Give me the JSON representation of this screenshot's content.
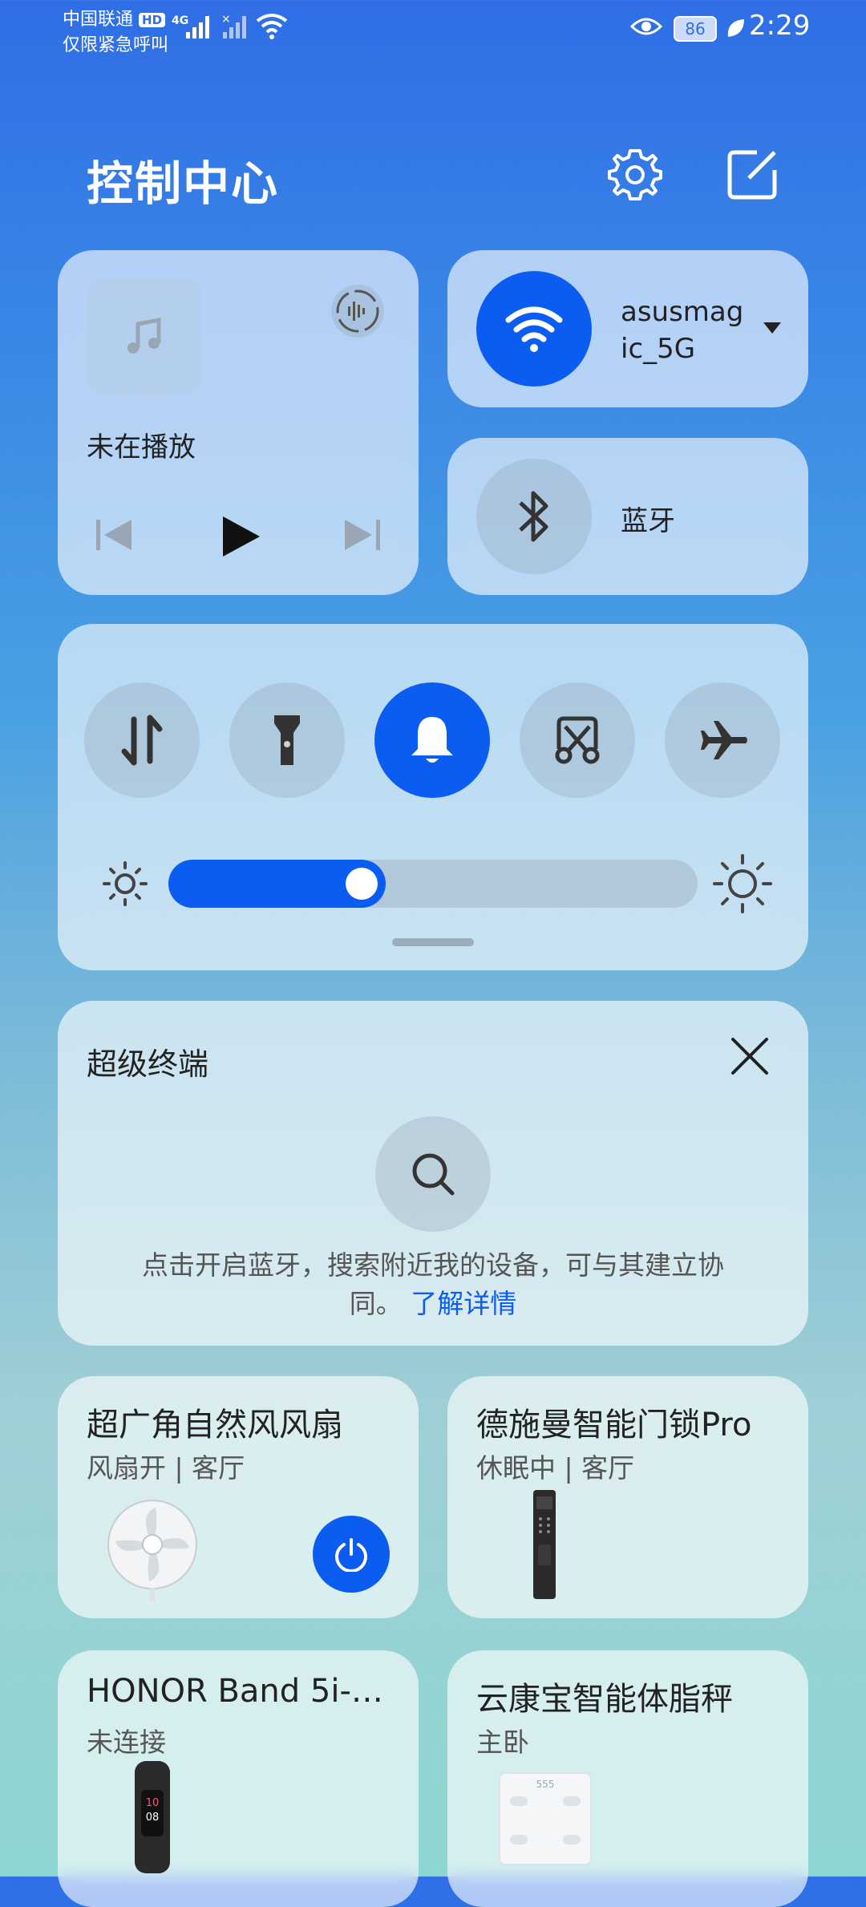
{
  "status": {
    "carrier": "中国联通",
    "hd": "HD",
    "emergency": "仅限紧急呼叫",
    "net": "4G",
    "battery": "86",
    "time": "2:29"
  },
  "header": {
    "title": "控制中心"
  },
  "media": {
    "status": "未在播放"
  },
  "wifi": {
    "ssid_line1": "asusmag",
    "ssid_line2": "ic_5G"
  },
  "bluetooth": {
    "label": "蓝牙"
  },
  "toggles": [
    {
      "name": "mobile-data",
      "active": false
    },
    {
      "name": "flashlight",
      "active": false
    },
    {
      "name": "sound",
      "active": true
    },
    {
      "name": "screenshot",
      "active": false
    },
    {
      "name": "airplane",
      "active": false
    }
  ],
  "brightness": {
    "level": 0.41
  },
  "superdevice": {
    "title": "超级终端",
    "desc_line1": "点击开启蓝牙，搜索附近我的设备，可与其建立协",
    "desc_line2": "同。",
    "link": "了解详情"
  },
  "devices": [
    {
      "title": "超广角自然风风扇",
      "status": "风扇开 | 客厅"
    },
    {
      "title": "德施曼智能门锁Pro",
      "status": "休眠中 | 客厅"
    },
    {
      "title": "HONOR Band 5i-…",
      "status": "未连接"
    },
    {
      "title": "云康宝智能体脂秤",
      "status": "主卧"
    }
  ],
  "band_screen": {
    "line1": "10",
    "line2": "08"
  },
  "scale_display": "555",
  "colors": {
    "accent": "#0b5cf0"
  }
}
